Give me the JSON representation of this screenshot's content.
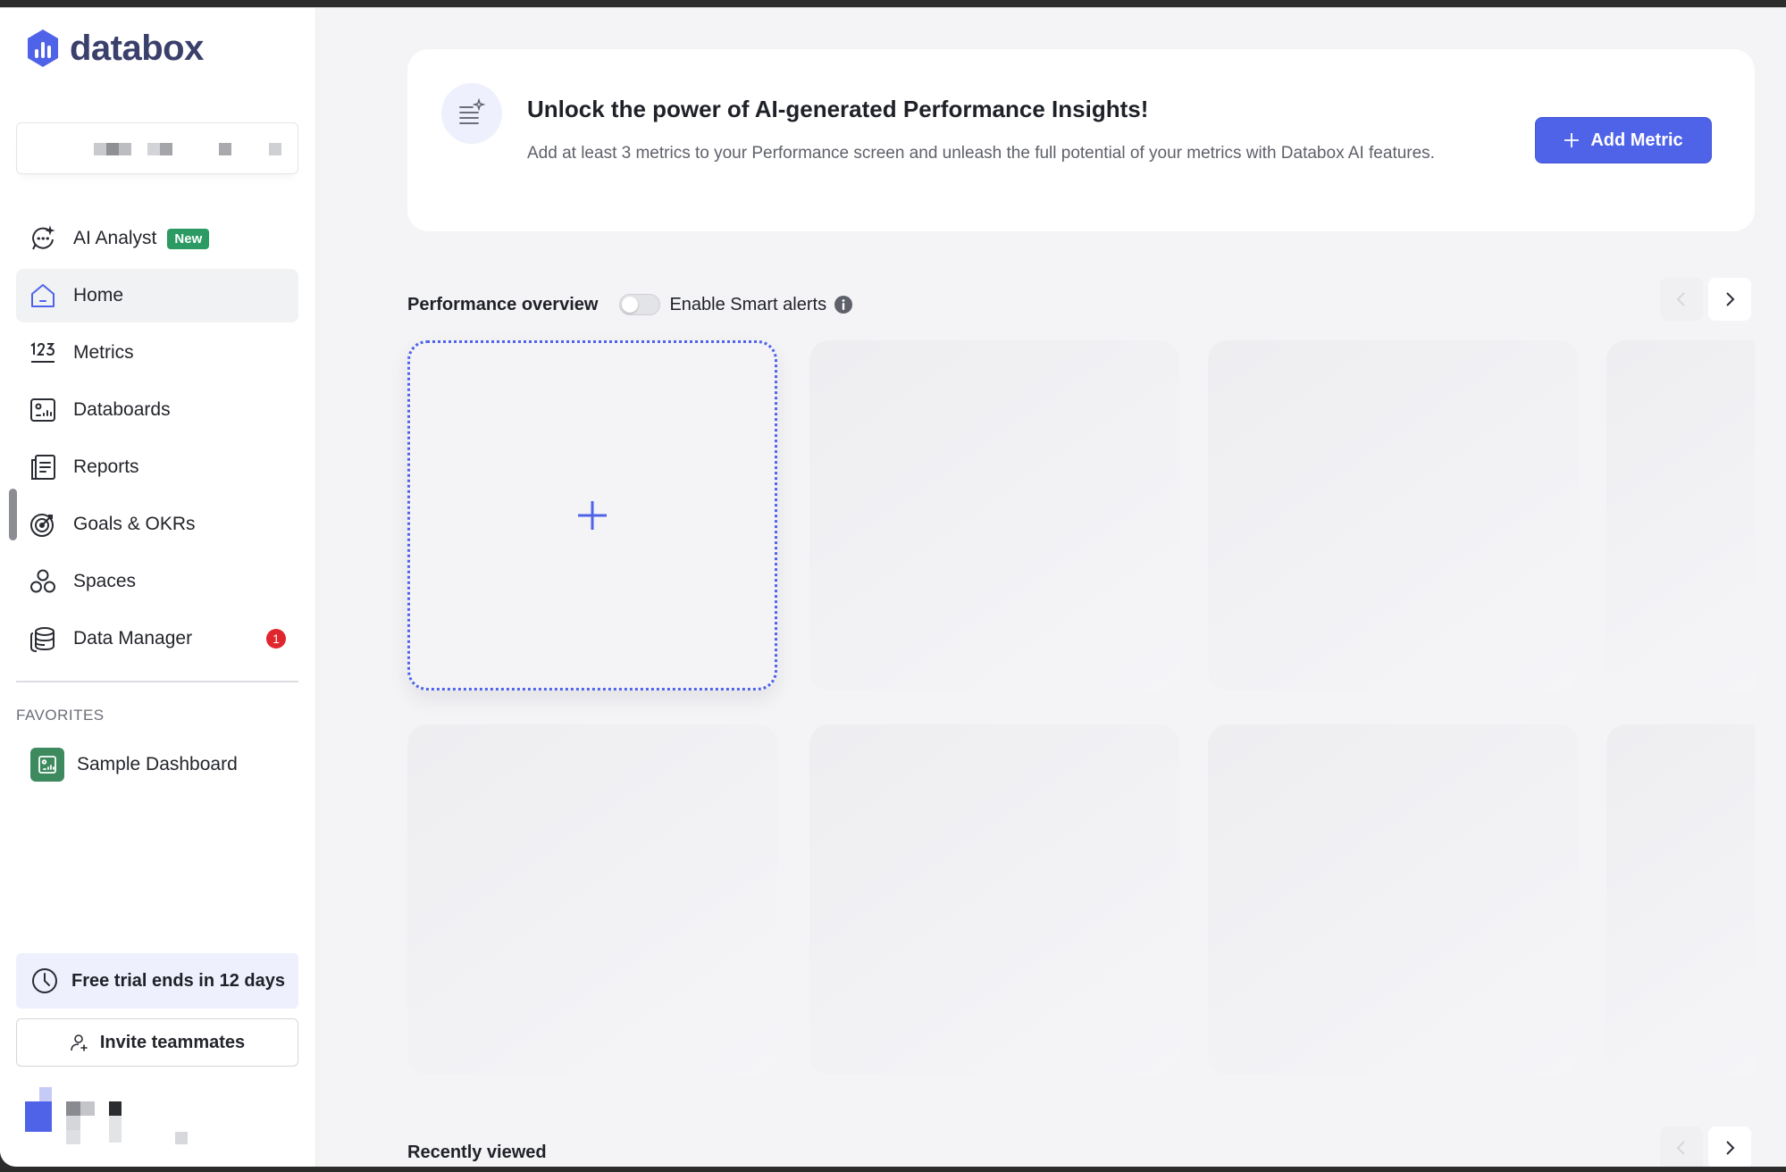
{
  "app": {
    "name": "databox",
    "accent_color": "#4f63e8"
  },
  "sidebar": {
    "items": [
      {
        "label": "AI Analyst",
        "icon": "ai-analyst-icon",
        "badge": "New"
      },
      {
        "label": "Home",
        "icon": "home-icon",
        "active": true
      },
      {
        "label": "Metrics",
        "icon": "numbers-icon"
      },
      {
        "label": "Databoards",
        "icon": "databoard-icon"
      },
      {
        "label": "Reports",
        "icon": "report-icon"
      },
      {
        "label": "Goals & OKRs",
        "icon": "target-icon"
      },
      {
        "label": "Spaces",
        "icon": "spaces-icon"
      },
      {
        "label": "Data Manager",
        "icon": "database-icon",
        "count": "1"
      }
    ],
    "favorites_header": "FAVORITES",
    "favorites": [
      {
        "label": "Sample Dashboard",
        "icon": "dashboard-icon"
      }
    ],
    "trial_text": "Free trial ends in 12 days",
    "invite_label": "Invite teammates"
  },
  "banner": {
    "title": "Unlock the power of AI-generated Performance Insights!",
    "description": "Add at least 3 metrics to your Performance screen and unleash the full potential of your metrics with Databox AI features.",
    "button_label": "Add Metric"
  },
  "performance": {
    "title": "Performance overview",
    "toggle_label": "Enable Smart alerts",
    "smart_alerts_enabled": false
  },
  "recently_viewed": {
    "title": "Recently viewed"
  }
}
